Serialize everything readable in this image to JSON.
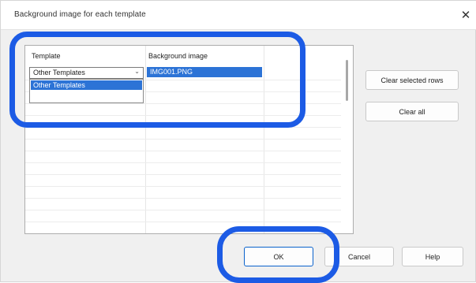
{
  "window": {
    "title": "Background image for each template",
    "close_glyph": "✕"
  },
  "grid": {
    "columns": [
      "Template",
      "Background image"
    ],
    "rows": [
      {
        "template": "Other Templates",
        "background_image": "IMG001.PNG"
      }
    ],
    "dropdown": {
      "open": true,
      "options": [
        "Other Templates"
      ],
      "selected_option": "Other Templates"
    }
  },
  "buttons": {
    "clear_selected_rows": "Clear selected rows",
    "clear_all": "Clear all",
    "ok": "OK",
    "cancel": "Cancel",
    "help": "Help"
  },
  "annotations": {
    "highlight_color": "#1c5be5",
    "highlighted_regions": [
      "template-grid",
      "ok-button"
    ]
  },
  "icons": {
    "close": "close-icon",
    "dropdown": "chevron-down-icon"
  }
}
